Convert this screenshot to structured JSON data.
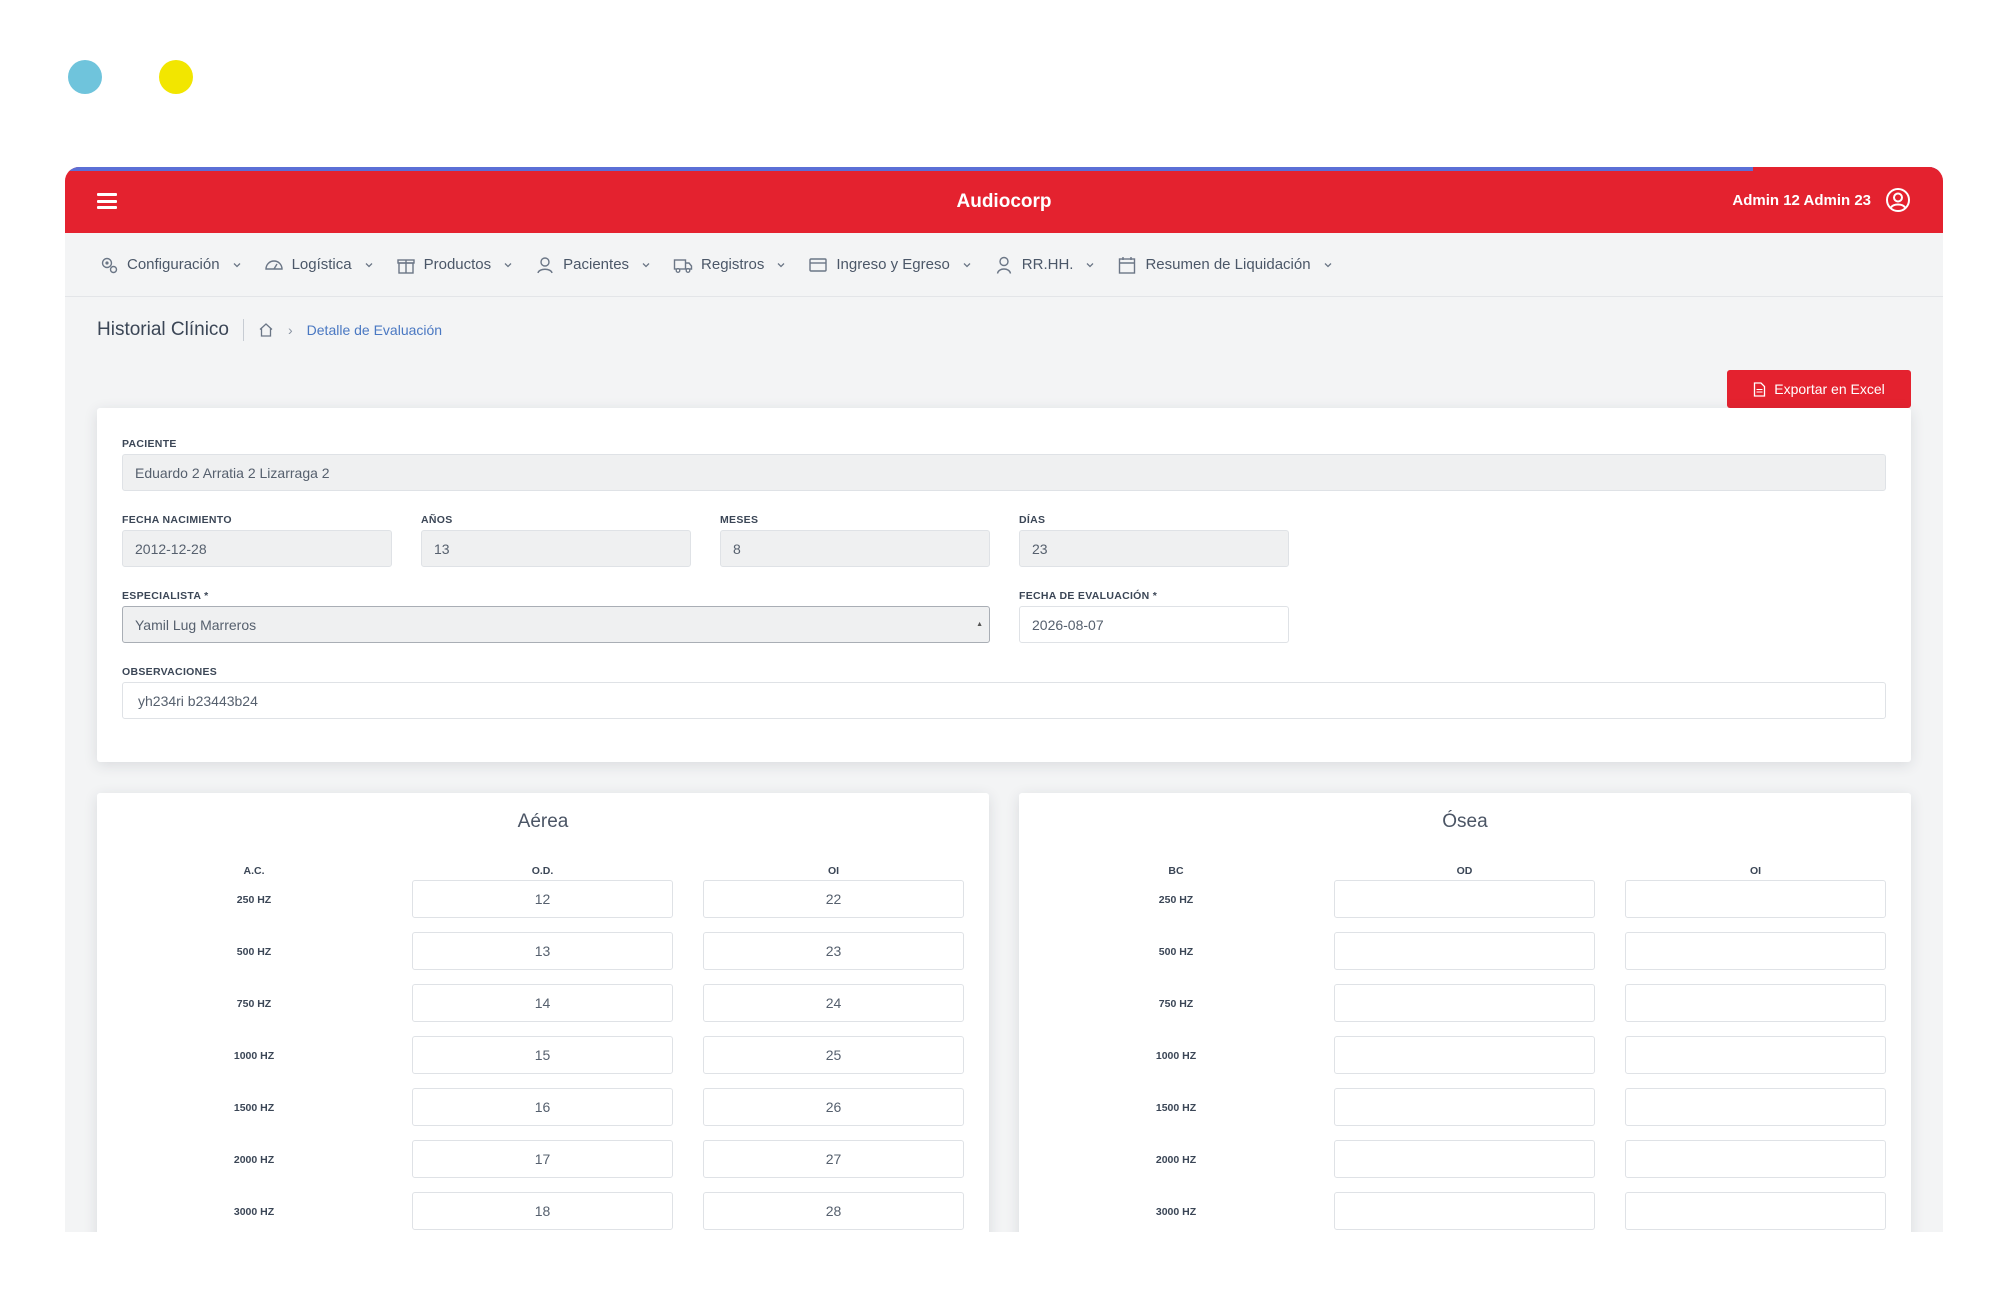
{
  "app": {
    "title": "Audiocorp",
    "user_name": "Admin 12 Admin 23"
  },
  "menu": [
    {
      "label": "Configuración",
      "icon": "gears-icon"
    },
    {
      "label": "Logística",
      "icon": "speedometer-icon"
    },
    {
      "label": "Productos",
      "icon": "gift-icon"
    },
    {
      "label": "Pacientes",
      "icon": "users-icon"
    },
    {
      "label": "Registros",
      "icon": "truck-icon"
    },
    {
      "label": "Ingreso y Egreso",
      "icon": "wallet-icon"
    },
    {
      "label": "RR.HH.",
      "icon": "user-icon"
    },
    {
      "label": "Resumen de Liquidación",
      "icon": "calendar-icon"
    }
  ],
  "breadcrumb": {
    "title": "Historial Clínico",
    "current": "Detalle de Evaluación"
  },
  "export_label": "Exportar en Excel",
  "form": {
    "paciente_label": "PACIENTE",
    "paciente": "Eduardo 2 Arratia 2 Lizarraga 2",
    "nacimiento_label": "FECHA NACIMIENTO",
    "nacimiento": "2012-12-28",
    "anos_label": "AÑOS",
    "anos": "13",
    "meses_label": "MESES",
    "meses": "8",
    "dias_label": "DÍAS",
    "dias": "23",
    "especialista_label": "ESPECIALISTA *",
    "especialista": "Yamil Lug Marreros",
    "fecha_eval_label": "FECHA DE EVALUACIÓN *",
    "fecha_eval": "2026-08-07",
    "observaciones_label": "OBSERVACIONES",
    "observaciones": "yh234ri b23443b24"
  },
  "aerea": {
    "title": "Aérea",
    "headers": [
      "A.C.",
      "O.D.",
      "OI"
    ],
    "rows": [
      {
        "freq": "250 HZ",
        "od": "12",
        "oi": "22"
      },
      {
        "freq": "500 HZ",
        "od": "13",
        "oi": "23"
      },
      {
        "freq": "750 HZ",
        "od": "14",
        "oi": "24"
      },
      {
        "freq": "1000 HZ",
        "od": "15",
        "oi": "25"
      },
      {
        "freq": "1500 HZ",
        "od": "16",
        "oi": "26"
      },
      {
        "freq": "2000 HZ",
        "od": "17",
        "oi": "27"
      },
      {
        "freq": "3000 HZ",
        "od": "18",
        "oi": "28"
      }
    ]
  },
  "osea": {
    "title": "Ósea",
    "headers": [
      "BC",
      "OD",
      "OI"
    ],
    "rows": [
      {
        "freq": "250 HZ",
        "od": "",
        "oi": ""
      },
      {
        "freq": "500 HZ",
        "od": "",
        "oi": ""
      },
      {
        "freq": "750 HZ",
        "od": "",
        "oi": ""
      },
      {
        "freq": "1000 HZ",
        "od": "",
        "oi": ""
      },
      {
        "freq": "1500 HZ",
        "od": "",
        "oi": ""
      },
      {
        "freq": "2000 HZ",
        "od": "",
        "oi": ""
      },
      {
        "freq": "3000 HZ",
        "od": "",
        "oi": ""
      }
    ]
  },
  "colors": {
    "brand_red": "#e4222f",
    "link_blue": "#4a78c2",
    "accent_blue": "#5b6fd6"
  }
}
